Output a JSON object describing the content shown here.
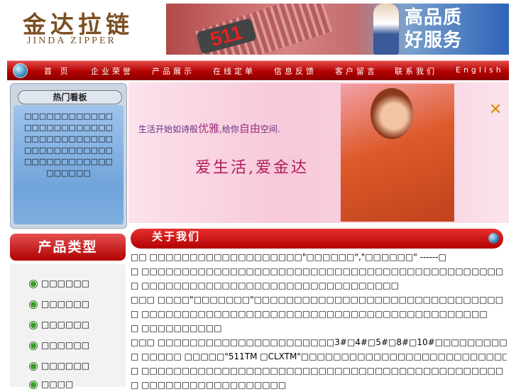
{
  "header": {
    "logo_cn": "金达拉链",
    "logo_en": "JINDA ZIPPER",
    "banner_number": "511",
    "banner_slogan_1": "高品质",
    "banner_slogan_2": "好服务"
  },
  "nav": {
    "items": [
      "首 页",
      "企业荣誉",
      "产品展示",
      "在线定单",
      "信息反馈",
      "客户留言",
      "联系我们",
      "English"
    ]
  },
  "board": {
    "title": "热门看板",
    "text": "□□□□□□□□□□□□□□□□□□□□□□□□□□□□□□□□□□□□□□□□□□□□□□□□□□□□□□□□□□□□□□□□□□"
  },
  "product_types": {
    "title": "产品类型",
    "items": [
      "□□□□□□",
      "□□□□□□",
      "□□□□□□",
      "□□□□□□",
      "□□□□□□",
      "□□□□"
    ]
  },
  "hero": {
    "line1_a": "生活开始如诗般",
    "line1_b": "优雅",
    "line1_c": ",给你",
    "line1_d": "自由",
    "line1_e": "空间.",
    "line2": "爱生活,爱金达"
  },
  "about": {
    "title": "关于我们",
    "lines": [
      "□□ □□□□□□□□□□□□□□□□□□□\"□□□□□□\",\"□□□□□□\" ------□",
      "□ □□□□□□□□□□□□□□□□□□□□□□□□□□□□□□□□□□□□□□□□□□□□□",
      "□ □□□□□□□□□□□□□□□□□□□□□□□□□□□□□□□□",
      "□□□ □□□□\"□□□□□□□\"□□□□□□□□□□□□□□□□□□□□□□□□□□□□□□□",
      "□ □□□□□□□□□□□□□□□□□□□□□□□□□□□□□□□□□□□□□□□□□□□",
      "□ □□□□□□□□□□",
      "□□□ □□□□□□□□□□□□□□□□□□□□□□3#□4#□5#□8#□10#□□□□□□□□□□□□□",
      "□ □□□□□ □□□□□\"511TM □CLXTM\"□□□□□□□□□□□□□□□□□□□□□□□□□□□",
      "□ □□□□□□□□□□□□□□□□□□□□□□□□□□□□□□□□□□□□□□□□□□□□□",
      "□ □□□□□□□□□□□□□□□□□□"
    ]
  }
}
